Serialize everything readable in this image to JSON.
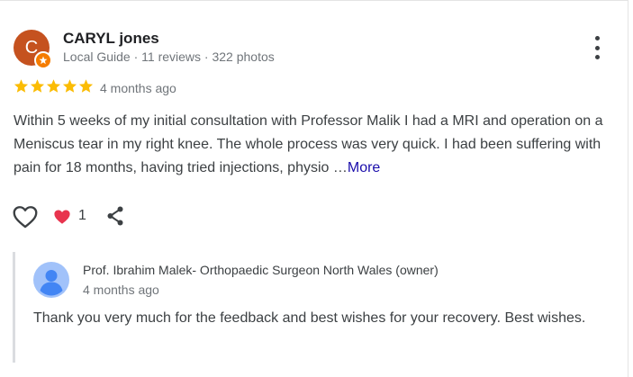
{
  "review": {
    "author": {
      "initial": "C",
      "name": "CARYL jones",
      "meta": "Local Guide · 11 reviews · 322 photos",
      "avatar_color": "#c5521f",
      "badge_color": "#f57c00"
    },
    "rating": 5,
    "star_color": "#fbbc04",
    "date": "4 months ago",
    "text": "Within 5 weeks of my initial consultation with Professor Malik I had a MRI and operation on a Meniscus tear in my right knee. The whole process was very quick. I had been suffering with pain for 18 months, having tried injections, physio …",
    "more_label": "More",
    "reactions": {
      "like_icon": "heart-outline-icon",
      "reaction_icon": "heart-filled-icon",
      "reaction_color": "#e8344e",
      "count": "1",
      "share_icon": "share-icon"
    },
    "menu_icon": "more-vertical-icon"
  },
  "owner_response": {
    "name": "Prof. Ibrahim Malek- Orthopaedic Surgeon North Wales (owner)",
    "date": "4 months ago",
    "text": "Thank you very much for the feedback and best wishes for your recovery. Best wishes.",
    "avatar_icon": "person-icon",
    "avatar_color": "#a1c2fa"
  }
}
